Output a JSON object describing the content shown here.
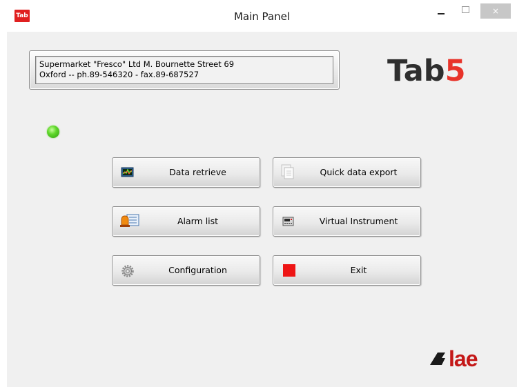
{
  "window": {
    "app_icon_text": "Tab",
    "title": "Main Panel",
    "close_glyph": "×"
  },
  "info": {
    "line1": "Supermarket \"Fresco\" Ltd  M. Bournette Street 69",
    "line2": "Oxford  --  ph.89-546320 - fax.89-687527"
  },
  "brand": {
    "logo_prefix": "Tab",
    "logo_suffix": "5",
    "vendor": "lae",
    "accent_color": "#e8332a"
  },
  "status": {
    "led_color": "#4fc81e"
  },
  "buttons": {
    "data_retrieve": "Data retrieve",
    "quick_export": "Quick data export",
    "alarm_list": "Alarm list",
    "virtual_instrument": "Virtual Instrument",
    "configuration": "Configuration",
    "exit": "Exit"
  },
  "icons": {
    "data_retrieve": "chart-monitor-icon",
    "quick_export": "documents-icon",
    "alarm_list": "alarm-list-icon",
    "virtual_instrument": "instrument-panel-icon",
    "configuration": "gear-icon",
    "exit": "red-square-icon"
  }
}
